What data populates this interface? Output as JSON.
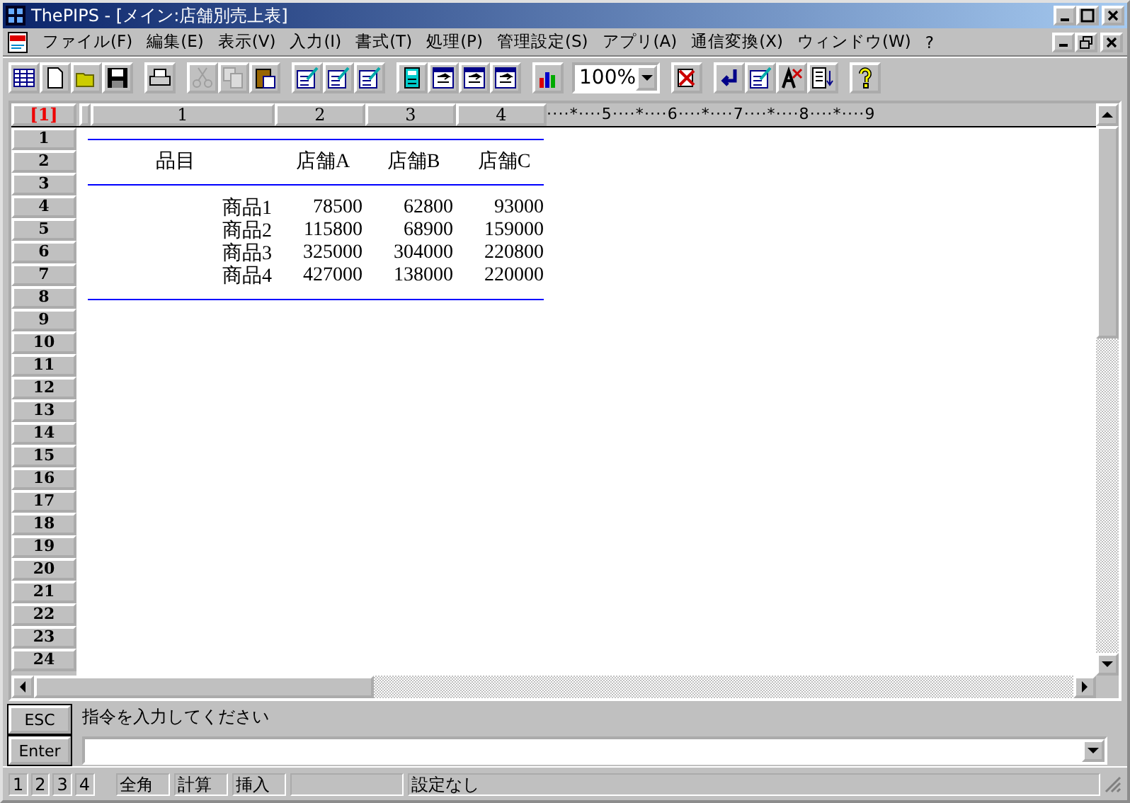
{
  "window": {
    "title": "ThePIPS - [メイン:店舗別売上表]"
  },
  "menu": [
    "ファイル(F)",
    "編集(E)",
    "表示(V)",
    "入力(I)",
    "書式(T)",
    "処理(P)",
    "管理設定(S)",
    "アプリ(A)",
    "通信変換(X)",
    "ウィンドウ(W)",
    "?"
  ],
  "toolbar": {
    "buttons": [
      {
        "disabled": false
      },
      {
        "disabled": false
      },
      {
        "disabled": false
      },
      {
        "disabled": false
      },
      {
        "disabled": false
      },
      {
        "disabled": true
      },
      {
        "disabled": true
      },
      {
        "disabled": false
      },
      {
        "disabled": false
      },
      {
        "disabled": false
      },
      {
        "disabled": false
      },
      {
        "disabled": false
      },
      {
        "disabled": false
      },
      {
        "disabled": false
      },
      {
        "disabled": false
      },
      {
        "disabled": false
      },
      {
        "disabled": false
      },
      {
        "disabled": false
      },
      {
        "disabled": false
      },
      {
        "disabled": false
      },
      {
        "disabled": false
      },
      {
        "disabled": false
      }
    ],
    "zoom": "100%"
  },
  "ruler": {
    "corner": "[1]",
    "columns": [
      "1",
      "2",
      "3",
      "4"
    ],
    "scale": "····*····5····*····6····*····7····*····8····*····9"
  },
  "row_numbers": [
    "1",
    "2",
    "3",
    "4",
    "5",
    "6",
    "7",
    "8",
    "9",
    "10",
    "11",
    "12",
    "13",
    "14",
    "15",
    "16",
    "17",
    "18",
    "19",
    "20",
    "21",
    "22",
    "23",
    "24"
  ],
  "table": {
    "columns": [
      "品目",
      "店舗A",
      "店舗B",
      "店舗C"
    ],
    "rows": [
      [
        "商品1",
        "78500",
        "62800",
        "93000"
      ],
      [
        "商品2",
        "115800",
        "68900",
        "159000"
      ],
      [
        "商品3",
        "325000",
        "304000",
        "220800"
      ],
      [
        "商品4",
        "427000",
        "138000",
        "220000"
      ]
    ]
  },
  "command": {
    "esc": "ESC",
    "enter": "Enter",
    "prompt": "指令を入力してください"
  },
  "status_bar": {
    "pages": [
      "1",
      "2",
      "3",
      "4"
    ],
    "modes": [
      "全角",
      "計算",
      "挿入"
    ],
    "message": "設定なし"
  }
}
